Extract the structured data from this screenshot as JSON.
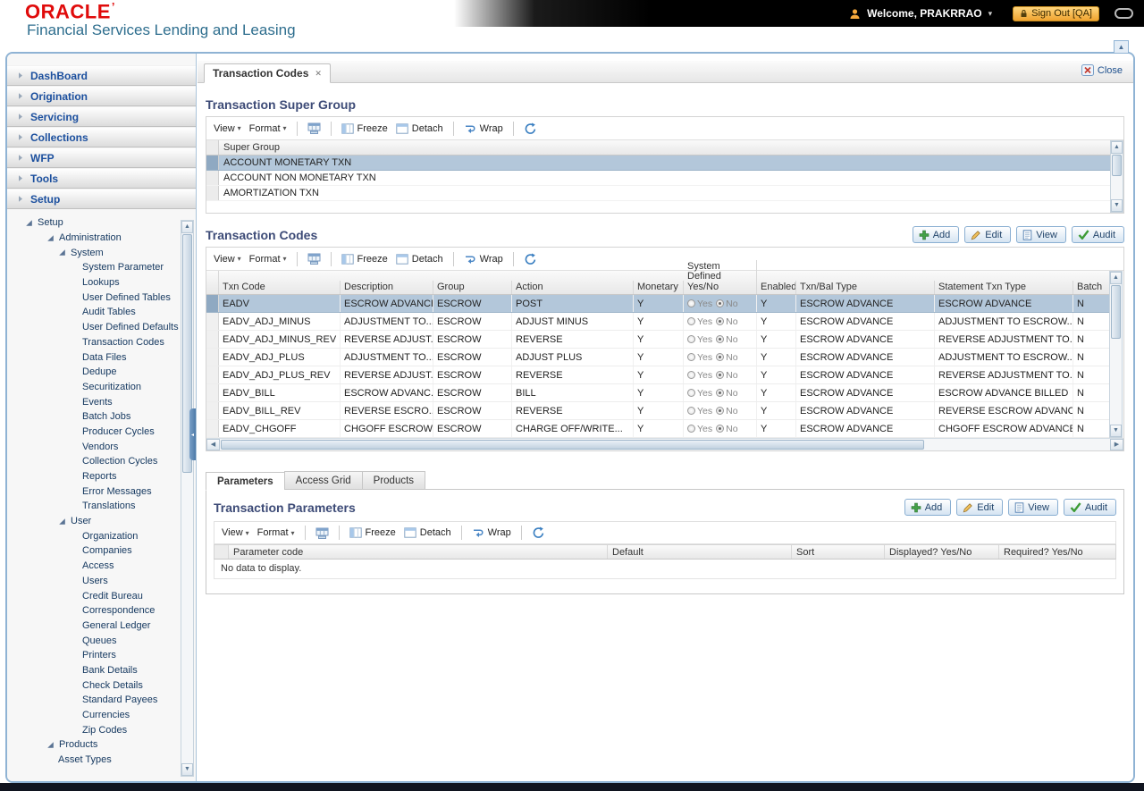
{
  "header": {
    "logo": "ORACLE",
    "subtitle": "Financial Services Lending and Leasing",
    "welcome": "Welcome, PRAKRRAO",
    "sign_out": "Sign Out [QA]"
  },
  "sidebar": {
    "menu": [
      {
        "label": "DashBoard"
      },
      {
        "label": "Origination"
      },
      {
        "label": "Servicing"
      },
      {
        "label": "Collections"
      },
      {
        "label": "WFP"
      },
      {
        "label": "Tools"
      },
      {
        "label": "Setup"
      }
    ],
    "tree": [
      {
        "label": "Setup",
        "level": 0,
        "node": true
      },
      {
        "label": "Administration",
        "level": 1,
        "node": true
      },
      {
        "label": "System",
        "level": 2,
        "node": true
      },
      {
        "label": "System Parameter",
        "level": 3
      },
      {
        "label": "Lookups",
        "level": 3
      },
      {
        "label": "User Defined Tables",
        "level": 3
      },
      {
        "label": "Audit Tables",
        "level": 3
      },
      {
        "label": "User Defined Defaults",
        "level": 3
      },
      {
        "label": "Transaction Codes",
        "level": 3
      },
      {
        "label": "Data Files",
        "level": 3
      },
      {
        "label": "Dedupe",
        "level": 3
      },
      {
        "label": "Securitization",
        "level": 3
      },
      {
        "label": "Events",
        "level": 3
      },
      {
        "label": "Batch Jobs",
        "level": 3
      },
      {
        "label": "Producer Cycles",
        "level": 3
      },
      {
        "label": "Vendors",
        "level": 3
      },
      {
        "label": "Collection Cycles",
        "level": 3
      },
      {
        "label": "Reports",
        "level": 3
      },
      {
        "label": "Error Messages",
        "level": 3
      },
      {
        "label": "Translations",
        "level": 3
      },
      {
        "label": "User",
        "level": 2,
        "node": true
      },
      {
        "label": "Organization",
        "level": 3
      },
      {
        "label": "Companies",
        "level": 3
      },
      {
        "label": "Access",
        "level": 3
      },
      {
        "label": "Users",
        "level": 3
      },
      {
        "label": "Credit Bureau",
        "level": 3
      },
      {
        "label": "Correspondence",
        "level": 3
      },
      {
        "label": "General Ledger",
        "level": 3
      },
      {
        "label": "Queues",
        "level": 3
      },
      {
        "label": "Printers",
        "level": 3
      },
      {
        "label": "Bank Details",
        "level": 3
      },
      {
        "label": "Check Details",
        "level": 3
      },
      {
        "label": "Standard Payees",
        "level": 3
      },
      {
        "label": "Currencies",
        "level": 3
      },
      {
        "label": "Zip Codes",
        "level": 3
      },
      {
        "label": "Products",
        "level": 1,
        "node": true
      },
      {
        "label": "Asset Types",
        "level": 2
      }
    ]
  },
  "workspace": {
    "tab": "Transaction Codes",
    "close": "Close"
  },
  "toolbar": {
    "view": "View",
    "format": "Format",
    "freeze": "Freeze",
    "detach": "Detach",
    "wrap": "Wrap"
  },
  "actions": {
    "add": "Add",
    "edit": "Edit",
    "view": "View",
    "audit": "Audit"
  },
  "super_group": {
    "title": "Transaction Super Group",
    "column": "Super Group",
    "rows": [
      "ACCOUNT MONETARY TXN",
      "ACCOUNT NON MONETARY TXN",
      "AMORTIZATION TXN"
    ],
    "selected_index": 0
  },
  "txn_codes": {
    "title": "Transaction Codes",
    "columns": [
      "Txn Code",
      "Description",
      "Group",
      "Action",
      "Monetary",
      "System Defined Yes/No",
      "Enabled",
      "Txn/Bal Type",
      "Statement Txn Type",
      "Batch"
    ],
    "radio_labels": {
      "yes": "Yes",
      "no": "No"
    },
    "selected_index": 0,
    "rows": [
      {
        "txn_code": "EADV",
        "description": "ESCROW ADVANCE",
        "group": "ESCROW",
        "action": "POST",
        "monetary": "Y",
        "system_defined": "No",
        "enabled": "Y",
        "txn_bal_type": "ESCROW ADVANCE",
        "statement_txn_type": "ESCROW ADVANCE",
        "batch": "N"
      },
      {
        "txn_code": "EADV_ADJ_MINUS",
        "description": "ADJUSTMENT TO...",
        "group": "ESCROW",
        "action": "ADJUST MINUS",
        "monetary": "Y",
        "system_defined": "No",
        "enabled": "Y",
        "txn_bal_type": "ESCROW ADVANCE",
        "statement_txn_type": "ADJUSTMENT TO ESCROW...",
        "batch": "N"
      },
      {
        "txn_code": "EADV_ADJ_MINUS_REV",
        "description": "REVERSE ADJUST...",
        "group": "ESCROW",
        "action": "REVERSE",
        "monetary": "Y",
        "system_defined": "No",
        "enabled": "Y",
        "txn_bal_type": "ESCROW ADVANCE",
        "statement_txn_type": "REVERSE ADJUSTMENT TO...",
        "batch": "N"
      },
      {
        "txn_code": "EADV_ADJ_PLUS",
        "description": "ADJUSTMENT TO...",
        "group": "ESCROW",
        "action": "ADJUST PLUS",
        "monetary": "Y",
        "system_defined": "No",
        "enabled": "Y",
        "txn_bal_type": "ESCROW ADVANCE",
        "statement_txn_type": "ADJUSTMENT TO ESCROW...",
        "batch": "N"
      },
      {
        "txn_code": "EADV_ADJ_PLUS_REV",
        "description": "REVERSE ADJUST...",
        "group": "ESCROW",
        "action": "REVERSE",
        "monetary": "Y",
        "system_defined": "No",
        "enabled": "Y",
        "txn_bal_type": "ESCROW ADVANCE",
        "statement_txn_type": "REVERSE ADJUSTMENT TO...",
        "batch": "N"
      },
      {
        "txn_code": "EADV_BILL",
        "description": "ESCROW ADVANC...",
        "group": "ESCROW",
        "action": "BILL",
        "monetary": "Y",
        "system_defined": "No",
        "enabled": "Y",
        "txn_bal_type": "ESCROW ADVANCE",
        "statement_txn_type": "ESCROW ADVANCE BILLED",
        "batch": "N"
      },
      {
        "txn_code": "EADV_BILL_REV",
        "description": "REVERSE ESCRO...",
        "group": "ESCROW",
        "action": "REVERSE",
        "monetary": "Y",
        "system_defined": "No",
        "enabled": "Y",
        "txn_bal_type": "ESCROW ADVANCE",
        "statement_txn_type": "REVERSE ESCROW ADVANC...",
        "batch": "N"
      },
      {
        "txn_code": "EADV_CHGOFF",
        "description": "CHGOFF ESCROW...",
        "group": "ESCROW",
        "action": "CHARGE OFF/WRITE...",
        "monetary": "Y",
        "system_defined": "No",
        "enabled": "Y",
        "txn_bal_type": "ESCROW ADVANCE",
        "statement_txn_type": "CHGOFF ESCROW ADVANCE",
        "batch": "N"
      }
    ]
  },
  "subtabs": [
    {
      "label": "Parameters",
      "active": true
    },
    {
      "label": "Access Grid",
      "active": false
    },
    {
      "label": "Products",
      "active": false
    }
  ],
  "parameters": {
    "title": "Transaction Parameters",
    "columns": [
      "Parameter code",
      "Default",
      "Sort",
      "Displayed? Yes/No",
      "Required? Yes/No"
    ],
    "empty": "No data to display."
  },
  "icons": {
    "user": "person",
    "sign_out": "padlock",
    "dropdown_caret": "caret-down",
    "menu_chevron": "chevron-right",
    "tree_node": "expanded-triangle",
    "tab_close": "x-mark",
    "close": "boxed-red-x",
    "export": "export-grid",
    "freeze": "freeze-columns",
    "detach": "detach-window",
    "wrap": "wrap-arrow",
    "refresh": "circular-arrows",
    "add": "green-plus",
    "edit": "pencil",
    "view": "document",
    "audit": "green-check",
    "scroll_up": "triangle-up",
    "scroll_down": "triangle-down",
    "scroll_left": "triangle-left",
    "scroll_right": "triangle-right"
  },
  "colors": {
    "frame_border": "#8fb3d4",
    "selected_row": "#b3c7da",
    "menu_text": "#1b4f9e",
    "heading": "#3d4b77",
    "oracle_red": "#e00b0b",
    "signout_orange": "#f0a32f"
  }
}
